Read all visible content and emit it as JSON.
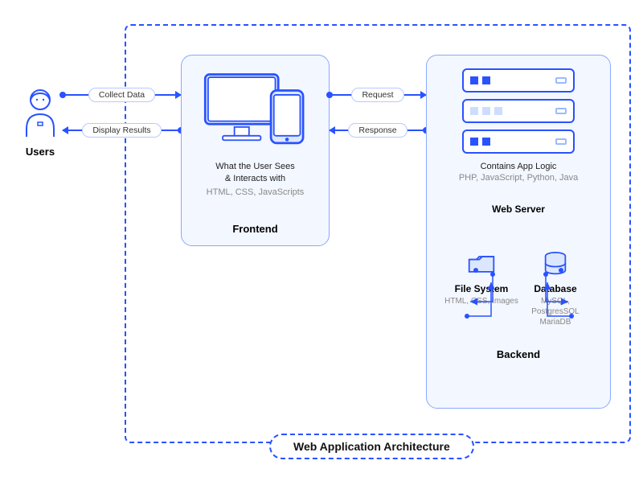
{
  "title": "Web Application Architecture",
  "user": {
    "label": "Users"
  },
  "arrows": {
    "user_to_frontend": {
      "forward": "Collect Data",
      "back": "Display Results"
    },
    "frontend_to_backend": {
      "forward": "Request",
      "back": "Response"
    }
  },
  "frontend": {
    "desc_line1": "What the User Sees",
    "desc_line2": "& Interacts with",
    "tech": "HTML, CSS, JavaScripts",
    "title": "Frontend"
  },
  "backend": {
    "app_logic_label": "Contains App Logic",
    "app_logic_tech": "PHP, JavaScript, Python, Java",
    "web_server_label": "Web Server",
    "file_system": {
      "title": "File System",
      "desc": "HTML, CSS, Images"
    },
    "database": {
      "title": "Database",
      "desc": "MySQL, PostgresSQL MariaDB"
    },
    "title": "Backend"
  }
}
